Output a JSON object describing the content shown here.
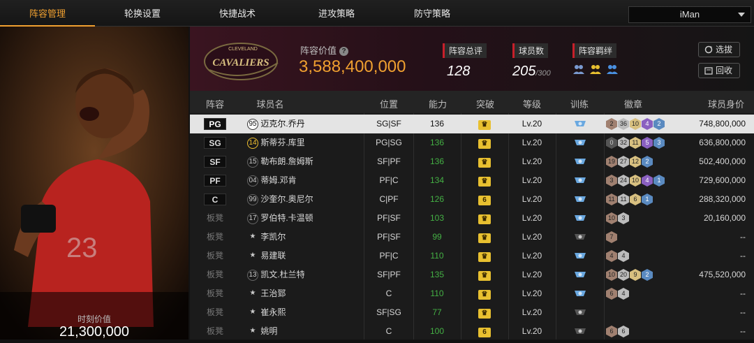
{
  "tabs": [
    "阵容管理",
    "轮换设置",
    "快捷战术",
    "进攻策略",
    "防守策略"
  ],
  "active_tab": 0,
  "user": {
    "name": "iMan"
  },
  "left_panel": {
    "caption": "时刻价值",
    "value": "21,300,000"
  },
  "header": {
    "team_logo_text": "CAVALIERS",
    "team_logo_city": "CLEVELAND",
    "lineup_value_label": "阵容价值",
    "lineup_value": "3,588,400,000",
    "rating_label": "阵容总评",
    "rating": "128",
    "players_label": "球员数",
    "players": "205",
    "players_max": "/300",
    "bond_label": "阵容羁绊",
    "select_btn": "选拔",
    "recycle_btn": "回收"
  },
  "columns": [
    "阵容",
    "球员名",
    "位置",
    "能力",
    "突破",
    "等级",
    "训练",
    "徽章",
    "球员身价"
  ],
  "rows": [
    {
      "slot": "PG",
      "num": "95",
      "name": "迈克尔.乔丹",
      "pos": "SG|SF",
      "ability": "136",
      "break": "crown",
      "level": "Lv.20",
      "train": "blue",
      "badges": [
        [
          "br",
          "2"
        ],
        [
          "si",
          "36"
        ],
        [
          "go",
          "10"
        ],
        [
          "pu",
          "4"
        ],
        [
          "bl",
          "2"
        ]
      ],
      "value": "748,800,000"
    },
    {
      "slot": "SG",
      "num": "14",
      "name": "斯蒂芬.库里",
      "pos": "PG|SG",
      "ability": "136",
      "break": "crown",
      "level": "Lv.20",
      "train": "blue",
      "badges": [
        [
          "dk",
          "0"
        ],
        [
          "si",
          "32"
        ],
        [
          "go",
          "11"
        ],
        [
          "pu",
          "5"
        ],
        [
          "bl",
          "3"
        ]
      ],
      "value": "636,800,000"
    },
    {
      "slot": "SF",
      "num": "15",
      "name": "勒布朗.詹姆斯",
      "pos": "SF|PF",
      "ability": "136",
      "break": "crown",
      "level": "Lv.20",
      "train": "blue",
      "badges": [
        [
          "br",
          "19"
        ],
        [
          "si",
          "27"
        ],
        [
          "go",
          "12"
        ],
        [
          "bl",
          "2"
        ]
      ],
      "value": "502,400,000"
    },
    {
      "slot": "PF",
      "num": "04",
      "name": "蒂姆.邓肯",
      "pos": "PF|C",
      "ability": "134",
      "break": "crown",
      "level": "Lv.20",
      "train": "blue",
      "badges": [
        [
          "br",
          "3"
        ],
        [
          "si",
          "24"
        ],
        [
          "go",
          "10"
        ],
        [
          "pu",
          "4"
        ],
        [
          "bl",
          "1"
        ]
      ],
      "value": "729,600,000"
    },
    {
      "slot": "C",
      "num": "99",
      "name": "沙奎尔.奥尼尔",
      "pos": "C|PF",
      "ability": "126",
      "break": "6",
      "level": "Lv.20",
      "train": "blue",
      "badges": [
        [
          "br",
          "11"
        ],
        [
          "si",
          "11"
        ],
        [
          "go",
          "6"
        ],
        [
          "bl",
          "1"
        ]
      ],
      "value": "288,320,000"
    },
    {
      "slot": "板凳",
      "num": "17",
      "name": "罗伯特.卡温顿",
      "pos": "PF|SF",
      "ability": "103",
      "break": "crown",
      "level": "Lv.20",
      "train": "blue",
      "badges": [
        [
          "br",
          "10"
        ],
        [
          "si",
          "3"
        ]
      ],
      "value": "20,160,000"
    },
    {
      "slot": "板凳",
      "num": "★",
      "name": "李凯尔",
      "pos": "PF|SF",
      "ability": "99",
      "break": "crown",
      "level": "Lv.20",
      "train": "grey",
      "badges": [
        [
          "br",
          "7"
        ]
      ],
      "value": "--"
    },
    {
      "slot": "板凳",
      "num": "★",
      "name": "易建联",
      "pos": "PF|C",
      "ability": "110",
      "break": "crown",
      "level": "Lv.20",
      "train": "blue",
      "badges": [
        [
          "br",
          "4"
        ],
        [
          "si",
          "4"
        ]
      ],
      "value": "--"
    },
    {
      "slot": "板凳",
      "num": "13",
      "name": "凯文.杜兰特",
      "pos": "SF|PF",
      "ability": "135",
      "break": "crown",
      "level": "Lv.20",
      "train": "blue",
      "badges": [
        [
          "br",
          "10"
        ],
        [
          "si",
          "20"
        ],
        [
          "go",
          "9"
        ],
        [
          "bl",
          "2"
        ]
      ],
      "value": "475,520,000"
    },
    {
      "slot": "板凳",
      "num": "★",
      "name": "王治郅",
      "pos": "C",
      "ability": "110",
      "break": "crown",
      "level": "Lv.20",
      "train": "blue",
      "badges": [
        [
          "br",
          "6"
        ],
        [
          "si",
          "4"
        ]
      ],
      "value": "--"
    },
    {
      "slot": "板凳",
      "num": "★",
      "name": "崔永熙",
      "pos": "SF|SG",
      "ability": "77",
      "break": "crown",
      "level": "Lv.20",
      "train": "grey",
      "badges": [],
      "value": "--"
    },
    {
      "slot": "板凳",
      "num": "★",
      "name": "姚明",
      "pos": "C",
      "ability": "100",
      "break": "6",
      "level": "Lv.20",
      "train": "grey",
      "badges": [
        [
          "br",
          "6"
        ],
        [
          "si",
          "6"
        ]
      ],
      "value": "--"
    }
  ]
}
